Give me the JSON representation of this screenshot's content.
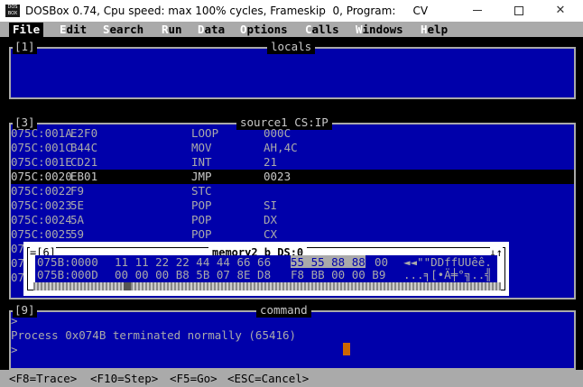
{
  "window": {
    "icon_text_1": "DOS",
    "icon_text_2": "BOX",
    "title": "DOSBox 0.74, Cpu speed: max 100% cycles, Frameskip  0, Program:     CV",
    "minimize_icon": "minimize-icon",
    "maximize_icon": "maximize-icon",
    "close_glyph": "✕"
  },
  "menu": [
    {
      "hot": "",
      "rest": "File"
    },
    {
      "hot": "E",
      "rest": "dit"
    },
    {
      "hot": "S",
      "rest": "earch"
    },
    {
      "hot": "R",
      "rest": "un"
    },
    {
      "hot": "D",
      "rest": "ata"
    },
    {
      "hot": "O",
      "rest": "ptions"
    },
    {
      "hot": "C",
      "rest": "alls"
    },
    {
      "hot": "W",
      "rest": "indows"
    },
    {
      "hot": "H",
      "rest": "elp"
    }
  ],
  "locals_pane": {
    "number": "[1]",
    "title": "locals"
  },
  "source_pane": {
    "number": "[3]",
    "title": "source1 CS:IP",
    "lines": [
      {
        "addr": "075C:001A",
        "bytes": "E2F0",
        "mnemonic": "LOOP",
        "operand": "000C"
      },
      {
        "addr": "075C:001C",
        "bytes": "B44C",
        "mnemonic": "MOV",
        "operand": "AH,4C"
      },
      {
        "addr": "075C:001E",
        "bytes": "CD21",
        "mnemonic": "INT",
        "operand": "21"
      },
      {
        "addr": "075C:0020",
        "bytes": "EB01",
        "mnemonic": "JMP",
        "operand": "0023"
      },
      {
        "addr": "075C:0022",
        "bytes": "F9",
        "mnemonic": "STC",
        "operand": ""
      },
      {
        "addr": "075C:0023",
        "bytes": "5E",
        "mnemonic": "POP",
        "operand": "SI"
      },
      {
        "addr": "075C:0024",
        "bytes": "5A",
        "mnemonic": "POP",
        "operand": "DX"
      },
      {
        "addr": "075C:0025",
        "bytes": "59",
        "mnemonic": "POP",
        "operand": "CX"
      },
      {
        "addr": "07",
        "bytes": "",
        "mnemonic": "",
        "operand": ""
      },
      {
        "addr": "07",
        "bytes": "",
        "mnemonic": "",
        "operand": ""
      },
      {
        "addr": "07",
        "bytes": "",
        "mnemonic": "",
        "operand": ""
      }
    ],
    "current_index": 3
  },
  "memory_window": {
    "number": "=[6]",
    "title": "memory2 b DS:0",
    "arrows": "↓↑",
    "rows": [
      {
        "addr": "075B:0000",
        "hex": "11 11 22 22 44 44 66 66",
        "hex_hl": "55 55 88 88",
        "hex_tail": "00",
        "ascii": "◄◄\"\"DDffUUêê."
      },
      {
        "addr": "075B:000D",
        "hex": "00 00 00 B8 5B 07 8E D8",
        "hex_hl": "",
        "hex_tail": "F8 BB 00 00 B9",
        "ascii": "...╕[•Ä╪°╗..╣"
      }
    ]
  },
  "command_pane": {
    "number": "[9]",
    "title": "command",
    "lines": [
      ">",
      "Process 0x074B terminated normally (65416)",
      ">"
    ]
  },
  "status_bar": [
    "<F8=Trace>",
    "<F10=Step>",
    "<F5=Go>",
    "<ESC=Cancel>"
  ]
}
